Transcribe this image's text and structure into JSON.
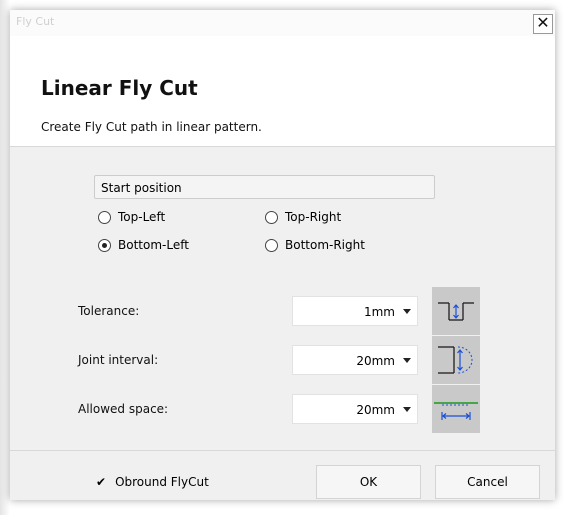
{
  "window": {
    "title": "Fly Cut",
    "close_glyph": "✕"
  },
  "header": {
    "title": "Linear Fly Cut",
    "description": "Create Fly Cut path in linear pattern."
  },
  "start_position": {
    "label": "Start position",
    "options": [
      {
        "label": "Top-Left",
        "checked": false
      },
      {
        "label": "Top-Right",
        "checked": false
      },
      {
        "label": "Bottom-Left",
        "checked": true
      },
      {
        "label": "Bottom-Right",
        "checked": false
      }
    ]
  },
  "fields": {
    "tolerance": {
      "label": "Tolerance:",
      "value": "1mm",
      "icon": "tolerance-icon"
    },
    "joint_interval": {
      "label": "Joint interval:",
      "value": "20mm",
      "icon": "joint-interval-icon"
    },
    "allowed_space": {
      "label": "Allowed space:",
      "value": "20mm",
      "icon": "allowed-space-icon"
    }
  },
  "footer": {
    "obround": {
      "label": "Obround FlyCut",
      "checked": true,
      "check_glyph": "✔"
    },
    "ok_label": "OK",
    "cancel_label": "Cancel"
  },
  "colors": {
    "icon_blue": "#1a4fd6",
    "icon_green": "#1a9a1a",
    "icon_bg": "#c9c9c9"
  }
}
